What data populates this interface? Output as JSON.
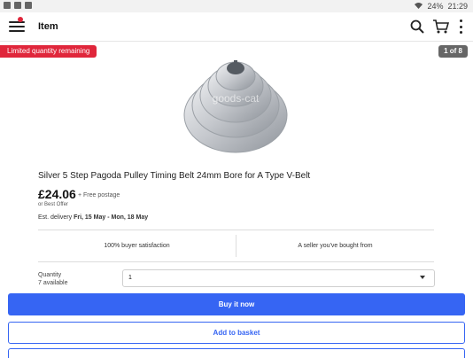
{
  "statusbar": {
    "battery": "24%",
    "time": "21:29"
  },
  "appbar": {
    "title": "Item",
    "icons": [
      "menu-icon",
      "search-icon",
      "cart-icon",
      "more-vert-icon"
    ]
  },
  "badges": {
    "promo": "Limited quantity remaining",
    "pager": "1 of 8"
  },
  "product": {
    "title": "Silver 5 Step Pagoda Pulley Timing Belt 24mm Bore for A Type V-Belt",
    "price": "£24.06",
    "postage": "+ Free postage",
    "best_offer": "or Best Offer",
    "delivery_label": "Est. delivery",
    "delivery_dates": "Fri, 15 May - Mon, 18 May",
    "image_watermark": "goods-cat"
  },
  "seller": {
    "satisfaction": "100% buyer satisfaction",
    "bought_before": "A seller you've bought from"
  },
  "quantity": {
    "label": "Quantity",
    "available": "7 available",
    "value": "1"
  },
  "actions": {
    "buy": "Buy it now",
    "add": "Add to basket"
  },
  "colors": {
    "accent": "#3665f3",
    "promo": "#e0263b"
  }
}
